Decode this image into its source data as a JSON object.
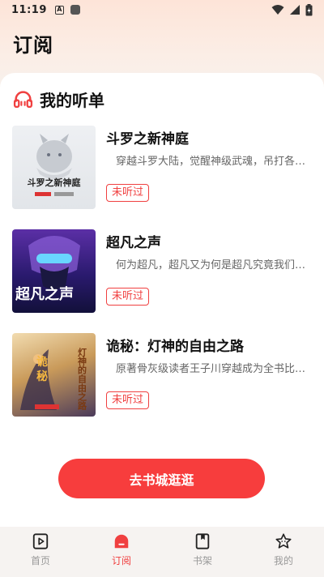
{
  "status_bar": {
    "time": "11:19",
    "left_icons": [
      "a-icon",
      "square-icon"
    ],
    "right_icons": [
      "wifi-icon",
      "signal-icon",
      "battery-icon"
    ]
  },
  "header": {
    "title": "订阅"
  },
  "section": {
    "title": "我的听单",
    "icon": "headphones-icon"
  },
  "books": [
    {
      "title": "斗罗之新神庭",
      "description": "穿越斗罗大陆，觉醒神级武魂，吊打各路...",
      "badge": "未听过",
      "cover_text": "斗罗之新神庭"
    },
    {
      "title": "超凡之声",
      "description": "何为超凡，超凡又为何是超凡究竟我们身...",
      "badge": "未听过",
      "cover_text": "超凡之声"
    },
    {
      "title": "诡秘：灯神的自由之路",
      "description": "原著骨灰级读者王子川穿越成为全书比惨...",
      "badge": "未听过",
      "cover_text": "诡秘 灯神的自由之路"
    }
  ],
  "cta": {
    "label": "去书城逛逛"
  },
  "bottom_nav": [
    {
      "label": "首页",
      "icon": "play-square-icon",
      "active": false
    },
    {
      "label": "订阅",
      "icon": "subscribe-icon",
      "active": true
    },
    {
      "label": "书架",
      "icon": "bookmark-icon",
      "active": false
    },
    {
      "label": "我的",
      "icon": "star-face-icon",
      "active": false
    }
  ],
  "colors": {
    "accent": "#f04040",
    "button": "#f73d3d"
  }
}
